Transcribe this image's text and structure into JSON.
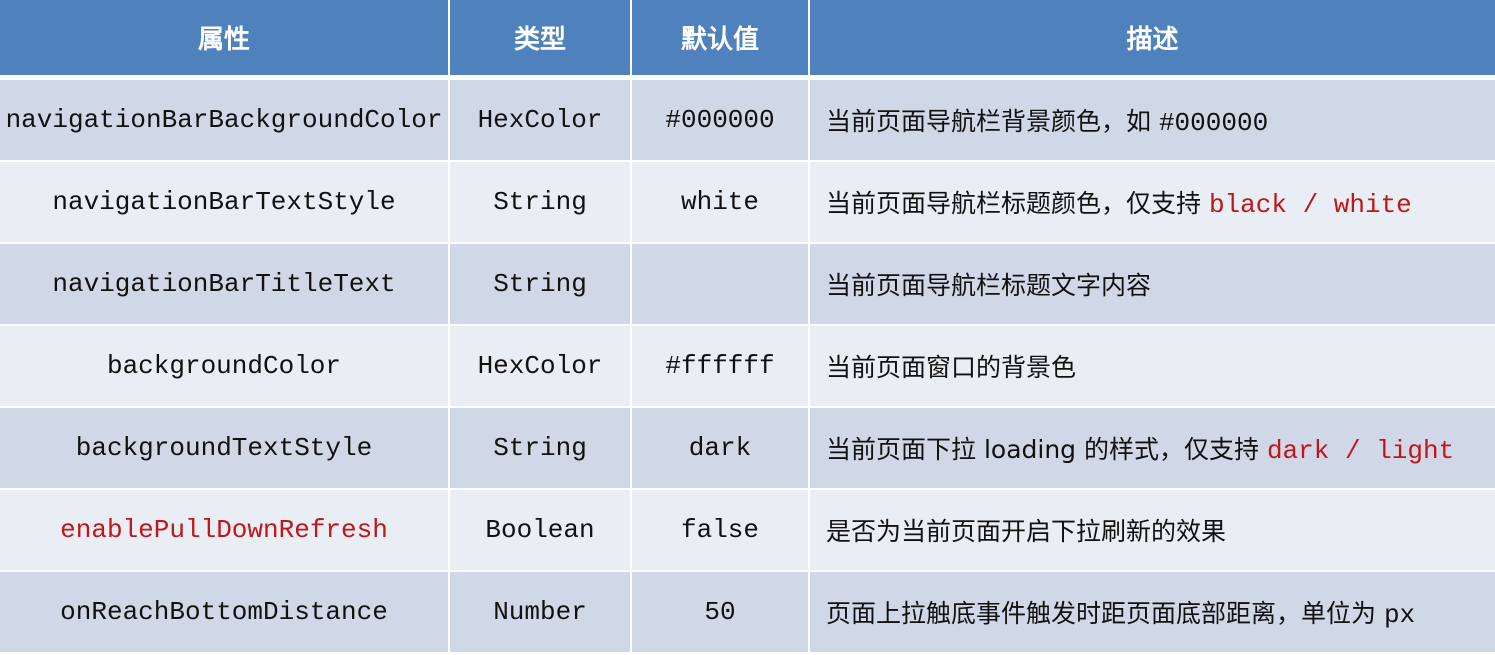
{
  "table": {
    "headers": [
      "属性",
      "类型",
      "默认值",
      "描述"
    ],
    "rows": [
      {
        "name": "navigationBarBackgroundColor",
        "type": "HexColor",
        "default": "#000000",
        "desc": "当前页面导航栏背景颜色，如 ",
        "desc_code": "#000000",
        "desc_red": "",
        "name_highlight": false
      },
      {
        "name": "navigationBarTextStyle",
        "type": "String",
        "default": "white",
        "desc": "当前页面导航栏标题颜色，仅支持 ",
        "desc_code": "",
        "desc_red": "black / white",
        "name_highlight": false
      },
      {
        "name": "navigationBarTitleText",
        "type": "String",
        "default": "",
        "desc": "当前页面导航栏标题文字内容",
        "desc_code": "",
        "desc_red": "",
        "name_highlight": false
      },
      {
        "name": "backgroundColor",
        "type": "HexColor",
        "default": "#ffffff",
        "desc": "当前页面窗口的背景色",
        "desc_code": "",
        "desc_red": "",
        "name_highlight": false
      },
      {
        "name": "backgroundTextStyle",
        "type": "String",
        "default": "dark",
        "desc": "当前页面下拉 loading 的样式，仅支持 ",
        "desc_code": "",
        "desc_red": "dark / light",
        "name_highlight": false
      },
      {
        "name": "enablePullDownRefresh",
        "type": "Boolean",
        "default": "false",
        "desc": "是否为当前页面开启下拉刷新的效果",
        "desc_code": "",
        "desc_red": "",
        "name_highlight": true
      },
      {
        "name": "onReachBottomDistance",
        "type": "Number",
        "default": "50",
        "desc": "页面上拉触底事件触发时距页面底部距离，单位为 ",
        "desc_code": "px",
        "desc_red": "",
        "name_highlight": false
      }
    ]
  },
  "colors": {
    "header_bg": "#4f81bd",
    "row_odd": "#d0d8e8",
    "row_even": "#e9edf4",
    "highlight": "#c0161a"
  }
}
